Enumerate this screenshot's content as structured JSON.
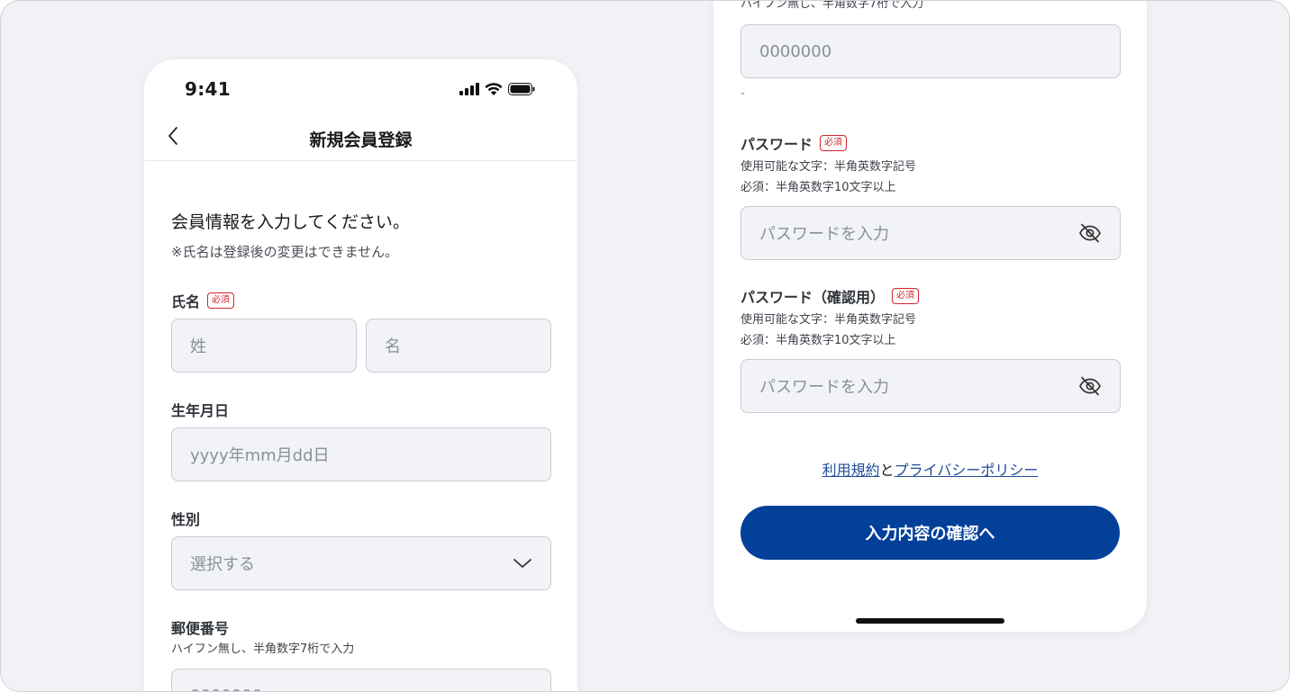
{
  "status_bar": {
    "time": "9:41"
  },
  "header": {
    "title": "新規会員登録"
  },
  "intro": {
    "heading": "会員情報を入力してください。",
    "note": "※氏名は登録後の変更はできません。"
  },
  "required_badge": "必須",
  "name": {
    "label": "氏名",
    "last_placeholder": "姓",
    "first_placeholder": "名"
  },
  "birthday": {
    "label": "生年月日",
    "placeholder": "yyyy年mm月dd日"
  },
  "gender": {
    "label": "性別",
    "placeholder": "選択する"
  },
  "postal": {
    "label": "郵便番号",
    "hint": "ハイフン無し、半角数字7桁で入力",
    "placeholder": "0000000",
    "separator": "-"
  },
  "password": {
    "label": "パスワード",
    "hint1": "使用可能な文字：半角英数字記号",
    "hint2": "必須：半角英数字10文字以上",
    "placeholder": "パスワードを入力"
  },
  "password_confirm": {
    "label": "パスワード（確認用）",
    "hint1": "使用可能な文字：半角英数字記号",
    "hint2": "必須：半角英数字10文字以上",
    "placeholder": "パスワードを入力"
  },
  "agreement": {
    "terms_link": "利用規約",
    "conjunction": "と",
    "privacy_link": "プライバシーポリシー"
  },
  "submit_label": "入力内容の確認へ",
  "icons": {
    "back": "chevron-left-icon",
    "signal": "signal-icon",
    "wifi": "wifi-icon",
    "battery": "battery-icon",
    "dropdown": "chevron-down-icon",
    "password_visibility": "eye-off-icon"
  },
  "colors": {
    "primary": "#02409a",
    "required": "#d2262f",
    "link": "#1e4d9b",
    "field_bg": "#f1f3f7"
  }
}
